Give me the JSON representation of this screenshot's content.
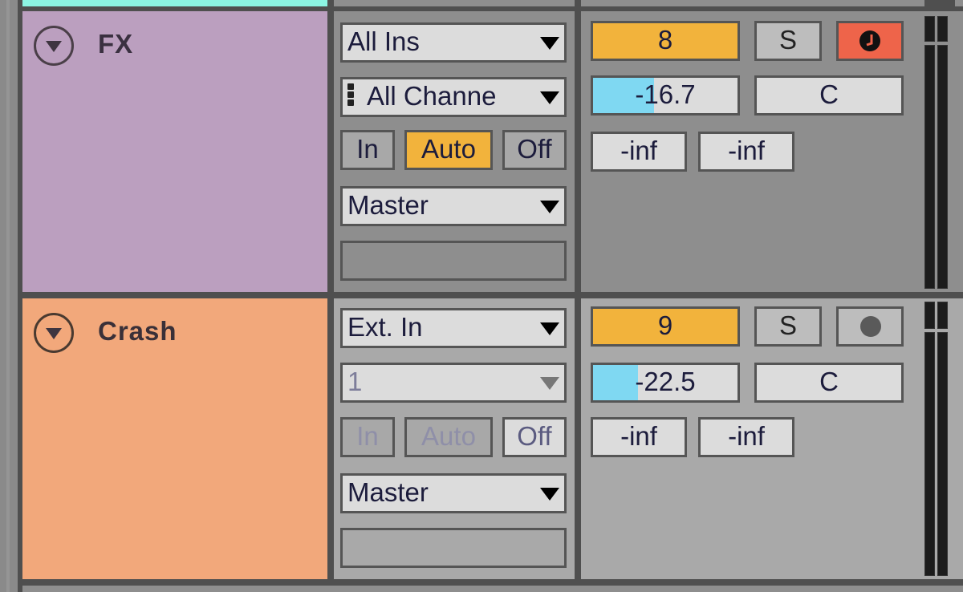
{
  "tracks": [
    {
      "name": "FX",
      "color": "#bb9fbf",
      "panel_bg": "#8e8e8e",
      "input_type": "All Ins",
      "input_channel": "All Channe",
      "input_channel_enabled": true,
      "monitor": {
        "in": "In",
        "auto": "Auto",
        "off": "Off",
        "active": "auto",
        "enabled": true
      },
      "output": "Master",
      "track_number": "8",
      "solo": "S",
      "arm_state": "armed",
      "volume": "-16.7",
      "volume_level_fraction": 0.42,
      "pan": "C",
      "sends": [
        "-inf",
        "-inf"
      ]
    },
    {
      "name": "Crash",
      "color": "#f2a87b",
      "panel_bg": "#a9a9a9",
      "input_type": "Ext. In",
      "input_channel": "1",
      "input_channel_enabled": false,
      "monitor": {
        "in": "In",
        "auto": "Auto",
        "off": "Off",
        "active": "off",
        "enabled": false
      },
      "output": "Master",
      "track_number": "9",
      "solo": "S",
      "arm_state": "disarmed",
      "volume": "-22.5",
      "volume_level_fraction": 0.31,
      "pan": "C",
      "sends": [
        "-inf",
        "-inf"
      ]
    }
  ],
  "colors": {
    "above_track": "#8cf5e3",
    "track_number_bg": "#f2b33c",
    "arm_active_bg": "#ee644a",
    "volume_fill": "#7fd8f2"
  }
}
